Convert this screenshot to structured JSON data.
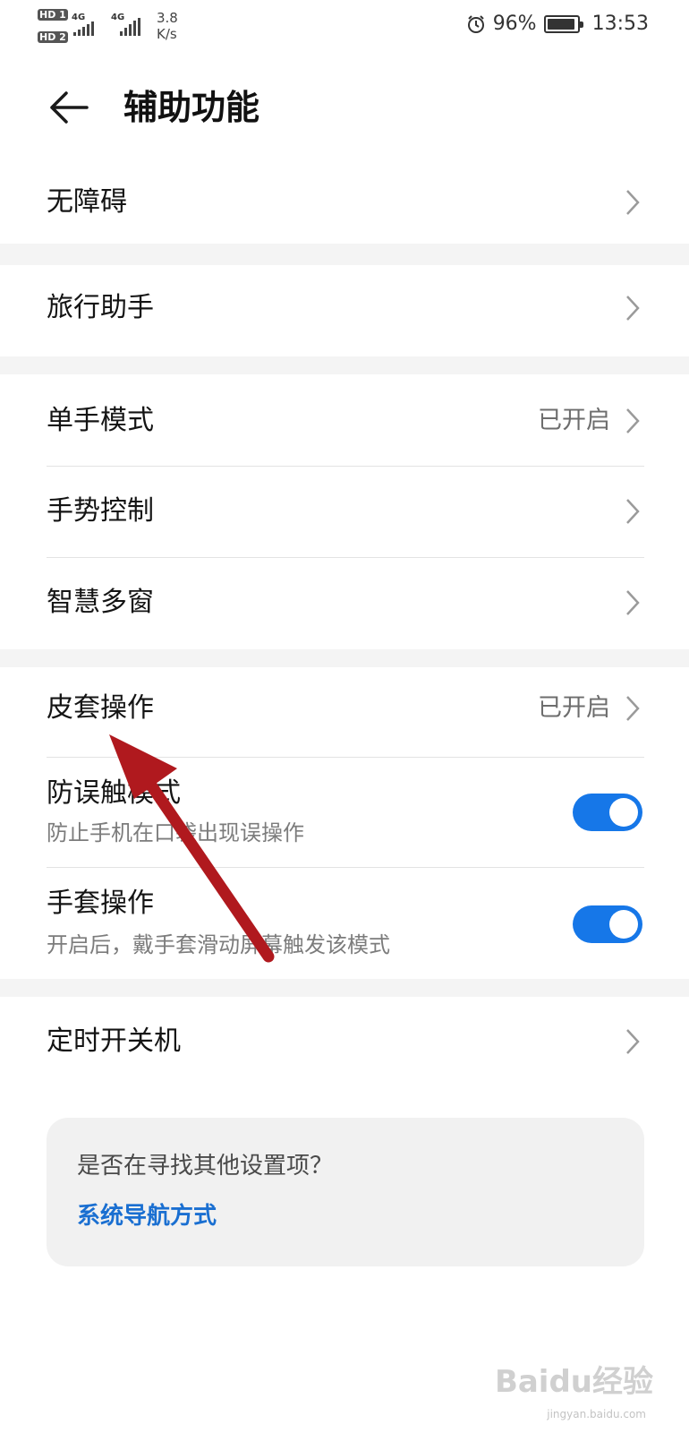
{
  "status_bar": {
    "hd1": "HD 1",
    "hd2": "HD 2",
    "sig1": "4G",
    "sig2": "4G",
    "speed_value": "3.8",
    "speed_unit": "K/s",
    "battery": "96%",
    "time": "13:53"
  },
  "header": {
    "title": "辅助功能"
  },
  "rows": {
    "accessibility": "无障碍",
    "travel": "旅行助手",
    "one_hand": {
      "label": "单手模式",
      "status": "已开启"
    },
    "gesture": "手势控制",
    "multi_window": "智慧多窗",
    "cover": {
      "label": "皮套操作",
      "status": "已开启"
    },
    "pocket": {
      "label": "防误触模式",
      "sub": "防止手机在口袋出现误操作",
      "on": true
    },
    "glove": {
      "label": "手套操作",
      "sub": "开启后，戴手套滑动屏幕触发该模式",
      "on": true
    },
    "timer_power": "定时开关机"
  },
  "suggestion": {
    "question": "是否在寻找其他设置项？",
    "link": "系统导航方式"
  },
  "watermark": {
    "brand": "Baidu经验",
    "url": "jingyan.baidu.com"
  },
  "colors": {
    "accent": "#1677e8",
    "link": "#1a6fd1",
    "annotation": "#b0191e"
  }
}
